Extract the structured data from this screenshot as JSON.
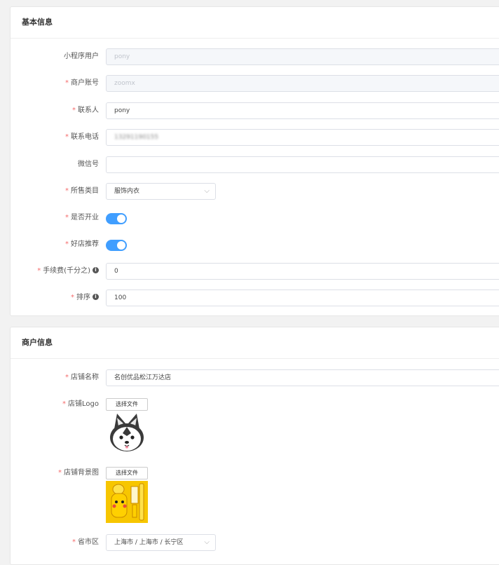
{
  "basic": {
    "title": "基本信息",
    "fields": {
      "miniprogram_user": {
        "label": "小程序用户",
        "value": "pony",
        "required": false
      },
      "merchant_account": {
        "label": "商户账号",
        "value": "zoomx",
        "required": true
      },
      "contact": {
        "label": "联系人",
        "value": "pony",
        "required": true
      },
      "phone": {
        "label": "联系电话",
        "value": "13291190155",
        "required": true
      },
      "wechat": {
        "label": "微信号",
        "value": "",
        "required": false
      },
      "category": {
        "label": "所售类目",
        "value": "服饰内衣",
        "required": true
      },
      "is_open": {
        "label": "是否开业",
        "on": true,
        "required": true
      },
      "recommended": {
        "label": "好店推荐",
        "on": true,
        "required": true
      },
      "fee": {
        "label": "手续费(千分之)",
        "value": "0",
        "required": true
      },
      "sort": {
        "label": "排序",
        "value": "100",
        "required": true
      }
    }
  },
  "merchant": {
    "title": "商户信息",
    "fields": {
      "store_name": {
        "label": "店铺名称",
        "value": "名创优品松江万达店",
        "required": true
      },
      "store_logo": {
        "label": "店铺Logo",
        "button": "选择文件",
        "required": true
      },
      "store_bg": {
        "label": "店铺背景图",
        "button": "选择文件",
        "required": true
      },
      "region": {
        "label": "省市区",
        "value": "上海市 / 上海市 / 长宁区",
        "required": true
      }
    }
  },
  "colors": {
    "accent": "#409eff",
    "required": "#f56c6c"
  },
  "icons": {
    "info": "info-icon",
    "dropdown": "chevron-down-icon"
  }
}
